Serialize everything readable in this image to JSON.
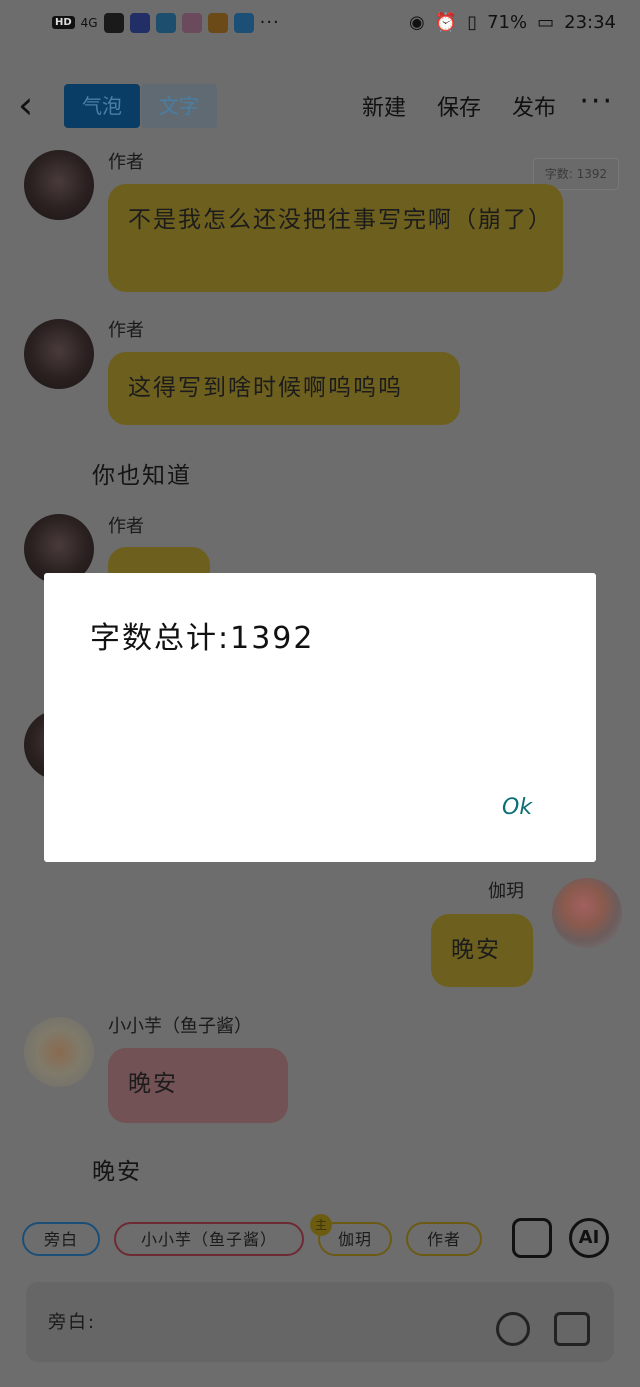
{
  "status_bar": {
    "hd": "HD",
    "signal": "4G",
    "battery_pct": "71%",
    "time": "23:34"
  },
  "toolbar": {
    "tab_bubble": "气泡",
    "tab_text": "文字",
    "new": "新建",
    "save": "保存",
    "publish": "发布",
    "more": "···"
  },
  "wordcount_badge": "字数: 1392",
  "messages": [
    {
      "name": "作者",
      "text": "不是我怎么还没把往事写完啊（崩了）"
    },
    {
      "name": "作者",
      "text": "这得写到啥时候啊呜呜呜"
    },
    {
      "narration": "你也知道"
    },
    {
      "name": "作者",
      "text": ""
    },
    {
      "name": "伽玥",
      "text": "晚安"
    },
    {
      "name": "小小芋（鱼子酱）",
      "text": "晚安"
    },
    {
      "narration": "晚安"
    }
  ],
  "chips": [
    "旁白",
    "小小芋（鱼子酱）",
    "伽玥",
    "作者"
  ],
  "crown_icon": "主",
  "ai_label": "AI",
  "input_label": "旁白:",
  "dialog": {
    "message": "字数总计:1392",
    "ok": "Ok"
  }
}
